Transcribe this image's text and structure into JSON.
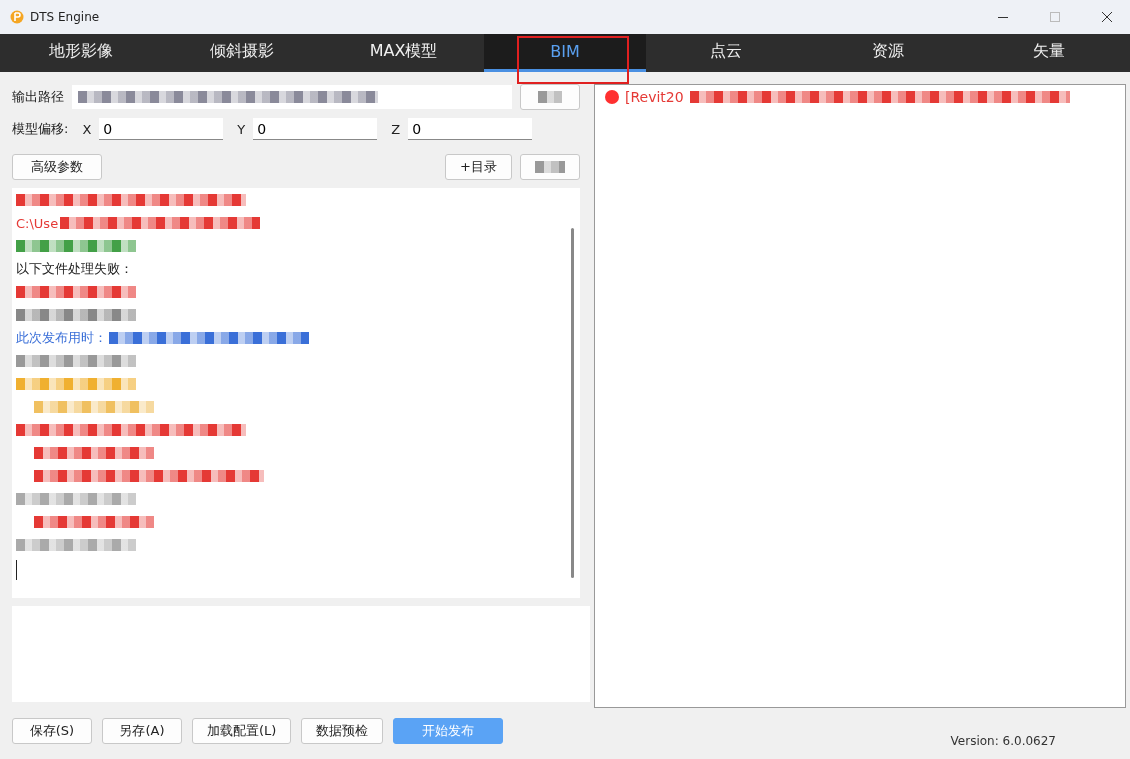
{
  "window": {
    "title": "DTS Engine"
  },
  "tabs": [
    {
      "label": "地形影像",
      "selected": false,
      "annotated": false
    },
    {
      "label": "倾斜摄影",
      "selected": false,
      "annotated": false
    },
    {
      "label": "MAX模型",
      "selected": false,
      "annotated": false
    },
    {
      "label": "BIM",
      "selected": true,
      "annotated": true
    },
    {
      "label": "点云",
      "selected": false,
      "annotated": false
    },
    {
      "label": "资源",
      "selected": false,
      "annotated": false
    },
    {
      "label": "矢量",
      "selected": false,
      "annotated": false
    }
  ],
  "output_path": {
    "label": "输出路径"
  },
  "offset": {
    "label": "模型偏移:",
    "axes": [
      {
        "axis": "X",
        "value": "0"
      },
      {
        "axis": "Y",
        "value": "0"
      },
      {
        "axis": "Z",
        "value": "0"
      }
    ]
  },
  "buttons_top": [
    {
      "label": "高级参数"
    },
    {
      "label": "+目录"
    }
  ],
  "log": [
    {
      "color": "#e53935",
      "blurred": true
    },
    {
      "text": "C:\\Use",
      "color": "#e53935",
      "blurred": true
    },
    {
      "color": "#43a047",
      "blurred": true
    },
    {
      "text": "以下文件处理失败：",
      "color": "#222222",
      "blurred": false
    },
    {
      "color": "#e53935",
      "blurred": true
    },
    {
      "color": "#888888",
      "blurred": true
    },
    {
      "text": "此次发布用时：",
      "color": "#3a6fd8",
      "blurred": true
    },
    {
      "color": "#999999",
      "blurred": true
    },
    {
      "color": "#f0b030",
      "blurred": true,
      "children": [
        {
          "color": "#f0c060",
          "blurred": true
        }
      ]
    },
    {
      "color": "#e53935",
      "blurred": true,
      "children": [
        {
          "color": "#e53935",
          "blurred": true
        },
        {
          "color": "#e53935",
          "blurred": true
        }
      ]
    },
    {
      "color": "#aaaaaa",
      "blurred": true,
      "children": [
        {
          "color": "#e53935",
          "blurred": true
        }
      ]
    },
    {
      "color": "#aaaaaa",
      "blurred": true
    }
  ],
  "tree": [
    {
      "text": "[Revit20",
      "color": "#e53935"
    }
  ],
  "buttons_bottom": [
    {
      "label": "保存(S)",
      "primary": false
    },
    {
      "label": "另存(A)",
      "primary": false
    },
    {
      "label": "加载配置(L)",
      "primary": false
    },
    {
      "label": "数据预检",
      "primary": false
    },
    {
      "label": "开始发布",
      "primary": true
    }
  ],
  "version": "Version: 6.0.0627"
}
